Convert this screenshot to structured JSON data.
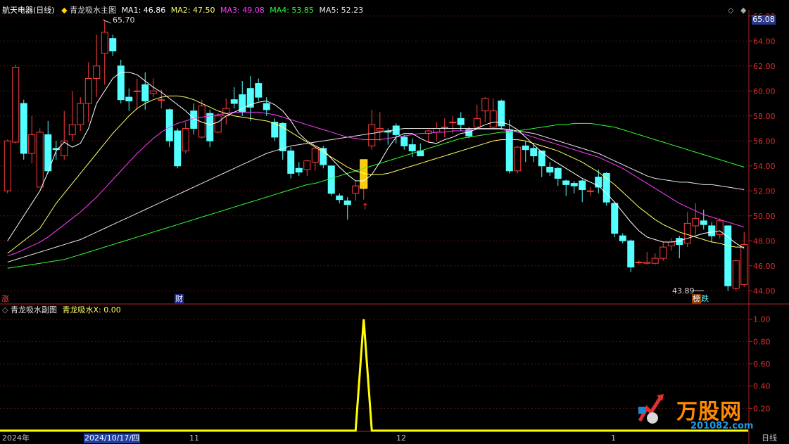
{
  "main_header": {
    "stock": "航天电器(日线)",
    "indicator": "青龙吸水主图",
    "ma1": "MA1: 46.86",
    "ma2": "MA2: 47.50",
    "ma3": "MA3: 49.08",
    "ma4": "MA4: 53.85",
    "ma5": "MA5: 52.23"
  },
  "sub_header": {
    "indicator": "青龙吸水副图",
    "value": "青龙吸水X: 0.00"
  },
  "current_price": "65.08",
  "markers": {
    "rise": "涨",
    "finance": "财",
    "list": "榜",
    "fall": "跌",
    "high_label": "65.70",
    "low_label": "43.89"
  },
  "x_axis": {
    "year": "2024年",
    "cursor_date": "2024/10/17/四",
    "m11": "11",
    "m12": "12",
    "m1": "1",
    "period": "日线"
  },
  "watermark": {
    "brand": "万股网",
    "url": "201082.com"
  },
  "colors": {
    "up": "#ff3d3d",
    "down": "#54ffff",
    "ma1": "#ffffff",
    "ma2": "#ffff66",
    "ma3": "#ff3dff",
    "ma4": "#33ff33",
    "ma5": "#e8e8e8",
    "signal": "#ffff00"
  },
  "chart_data": [
    {
      "type": "candlestick",
      "title": "青龙吸水主图",
      "y_range": [
        43,
        67
      ],
      "y_ticks": [
        "44.00",
        "46.00",
        "48.00",
        "50.00",
        "52.00",
        "54.00",
        "56.00",
        "58.00",
        "60.00",
        "62.00",
        "64.00",
        "66.00"
      ],
      "candles": [
        [
          52,
          56,
          51.8,
          56.1
        ],
        [
          55.9,
          61.9,
          55.8,
          62.1
        ],
        [
          59,
          55,
          54.5,
          59.3
        ],
        [
          55,
          56.5,
          54.2,
          58
        ],
        [
          52.3,
          56.7,
          52.3,
          57
        ],
        [
          56.5,
          53.6,
          53.4,
          57.6
        ],
        [
          55.4,
          55.3,
          54.5,
          56
        ],
        [
          54.8,
          56,
          54.5,
          58.4
        ],
        [
          56.5,
          57.3,
          56,
          60
        ],
        [
          57.3,
          59,
          56.8,
          59.5
        ],
        [
          59,
          61,
          57.5,
          62.3
        ],
        [
          61,
          62,
          59.5,
          64.5
        ],
        [
          63,
          64.7,
          60.5,
          65.7
        ],
        [
          64.2,
          63.2,
          62.8,
          64.5
        ],
        [
          62,
          59.3,
          59,
          62.5
        ],
        [
          59.5,
          59.2,
          58.4,
          60.2
        ],
        [
          60,
          60,
          58.5,
          61
        ],
        [
          60.5,
          59.2,
          58.5,
          61.5
        ],
        [
          59.8,
          60,
          59.5,
          61
        ],
        [
          59.3,
          59.3,
          58.6,
          60.1
        ],
        [
          58.5,
          56,
          55.5,
          58.6
        ],
        [
          56.8,
          54,
          53.8,
          57
        ],
        [
          55.2,
          57,
          55,
          57.5
        ],
        [
          58.4,
          57,
          56.5,
          59
        ],
        [
          56.3,
          58.8,
          56.2,
          59.3
        ],
        [
          58.2,
          56,
          55.5,
          58.5
        ],
        [
          56.7,
          58,
          56.6,
          58.2
        ],
        [
          58,
          58.6,
          57.3,
          59.4
        ],
        [
          59.3,
          59,
          58.6,
          60.3
        ],
        [
          59.7,
          58.3,
          58,
          60.8
        ],
        [
          60.2,
          58.7,
          57.6,
          61.2
        ],
        [
          60.6,
          59.5,
          59.2,
          61
        ],
        [
          59,
          58.5,
          58,
          59.5
        ],
        [
          57.5,
          56.3,
          56,
          57.8
        ],
        [
          57.4,
          55.2,
          54.5,
          57.5
        ],
        [
          55.2,
          53.4,
          53,
          55.5
        ],
        [
          53.8,
          53.5,
          53.2,
          54.3
        ],
        [
          53.7,
          54.4,
          53.2,
          54.5
        ],
        [
          54.3,
          55.4,
          53.6,
          55.5
        ],
        [
          55.4,
          54.1,
          53.8,
          55.6
        ],
        [
          54,
          51.8,
          51.6,
          54
        ],
        [
          51.6,
          51.3,
          51,
          51.8
        ],
        [
          51.2,
          50.9,
          49.7,
          51.5
        ],
        [
          51.8,
          52.4,
          51.2,
          52.8
        ],
        [
          52.2,
          54.5,
          51.3,
          54.5
        ],
        [
          55.6,
          57.3,
          55.3,
          58.5
        ],
        [
          56.8,
          57,
          56,
          58.3
        ],
        [
          56.8,
          56.7,
          55.7,
          57
        ],
        [
          57.2,
          56.5,
          55.8,
          57.4
        ],
        [
          56.3,
          55.6,
          55.3,
          56.5
        ],
        [
          55.7,
          55.2,
          54.7,
          56.2
        ],
        [
          55.2,
          54.8,
          54.8,
          55.8
        ],
        [
          56.6,
          56.8,
          55.9,
          56.9
        ],
        [
          56.7,
          57,
          56,
          57.5
        ],
        [
          57.1,
          57.1,
          56.3,
          57.8
        ],
        [
          57.5,
          57.5,
          56.6,
          58
        ],
        [
          57.8,
          57.3,
          56.8,
          58.3
        ],
        [
          56.9,
          56.4,
          56.2,
          57.1
        ],
        [
          57.1,
          57.8,
          57,
          58.9
        ],
        [
          58.4,
          59.4,
          57.5,
          59.5
        ],
        [
          57.1,
          58.4,
          57,
          59.4
        ],
        [
          59.2,
          57.2,
          56.9,
          59.3
        ],
        [
          56.9,
          53.6,
          53.4,
          57.7
        ],
        [
          53.6,
          55.5,
          53.4,
          55.6
        ],
        [
          55.6,
          55.3,
          54.3,
          56
        ],
        [
          55.4,
          54.8,
          54.3,
          55.8
        ],
        [
          55.2,
          54,
          53.1,
          55.2
        ],
        [
          53.9,
          53.5,
          53.2,
          54.3
        ],
        [
          53.8,
          53,
          52.4,
          53.9
        ],
        [
          52.8,
          52.5,
          51.6,
          52.9
        ],
        [
          52.6,
          52.4,
          51.8,
          52.8
        ],
        [
          52.8,
          52.1,
          51.1,
          52.9
        ],
        [
          52,
          52,
          51.6,
          52.3
        ],
        [
          53.1,
          52.3,
          51.8,
          53.7
        ],
        [
          53.4,
          51.1,
          50.8,
          53.5
        ],
        [
          51,
          48.6,
          48.3,
          51.1
        ],
        [
          48.4,
          48,
          47.8,
          48.6
        ],
        [
          48,
          45.9,
          45.5,
          48.1
        ],
        [
          46.3,
          46.3,
          46.1,
          46.4
        ],
        [
          46.2,
          46.3,
          46.1,
          47.1
        ],
        [
          46.2,
          46.6,
          46.1,
          47
        ],
        [
          46.6,
          47.5,
          46.4,
          47.9
        ],
        [
          47.6,
          47.9,
          47.2,
          48.2
        ],
        [
          48.2,
          47.7,
          46.6,
          48.4
        ],
        [
          47.8,
          49.4,
          47.5,
          50.3
        ],
        [
          49.2,
          49.8,
          48.5,
          51
        ],
        [
          49.6,
          49.3,
          48.9,
          50.5
        ],
        [
          49.2,
          48.4,
          47.9,
          49.5
        ],
        [
          48.5,
          49.6,
          48.2,
          49.8
        ],
        [
          49.2,
          44.4,
          44,
          49.2
        ],
        [
          44.2,
          46.4,
          44,
          46.5
        ],
        [
          44.5,
          47.7,
          44.3,
          48.7
        ]
      ],
      "ma1_values": [
        48,
        49,
        50,
        51,
        52,
        53.5,
        55.2,
        55.9,
        55.5,
        55.8,
        57,
        59,
        60,
        61,
        61.5,
        61.5,
        61.3,
        60.8,
        60.3,
        59.9,
        59.4,
        58.9,
        58.4,
        57.8,
        57.5,
        57.3,
        57.5,
        58,
        58.3,
        58.6,
        58.9,
        59.1,
        59.2,
        58.9,
        58.4,
        57.6,
        56.6,
        56,
        55.6,
        55.3,
        54.6,
        53.9,
        53.3,
        52.8,
        52.8,
        53.3,
        54.3,
        55.4,
        56.3,
        56.6,
        56.6,
        56.2,
        55.9,
        55.8,
        56.1,
        56.3,
        56.6,
        56.7,
        57,
        57.3,
        57.5,
        57.5,
        57.3,
        56.9,
        56.3,
        55.7,
        55.1,
        54.6,
        54.2,
        53.8,
        53.4,
        53,
        52.7,
        52.4,
        51.8,
        51.1,
        50.3,
        49.5,
        48.8,
        48.3,
        48.1,
        47.9,
        47.9,
        48,
        48.2,
        48.4,
        48.6,
        48.7,
        48.8,
        48.3,
        47.8,
        47.4
      ],
      "ma2_values": [
        47,
        47.5,
        48,
        48.5,
        49,
        50,
        51,
        51.8,
        52.6,
        53.4,
        54.2,
        55,
        55.8,
        56.6,
        57.3,
        58,
        58.6,
        59,
        59.3,
        59.5,
        59.6,
        59.6,
        59.5,
        59.3,
        59,
        58.7,
        58.4,
        58.2,
        58,
        57.9,
        57.8,
        57.7,
        57.6,
        57.4,
        57.1,
        56.7,
        56.3,
        55.9,
        55.5,
        55.1,
        54.7,
        54.3,
        53.9,
        53.6,
        53.4,
        53.3,
        53.3,
        53.4,
        53.6,
        53.8,
        54,
        54.2,
        54.4,
        54.6,
        54.8,
        55,
        55.2,
        55.4,
        55.6,
        55.8,
        56,
        56.1,
        56.1,
        56.1,
        56,
        55.8,
        55.6,
        55.4,
        55.2,
        54.9,
        54.6,
        54.3,
        53.9,
        53.5,
        53,
        52.5,
        51.9,
        51.3,
        50.7,
        50.2,
        49.7,
        49.3,
        49,
        48.7,
        48.5,
        48.3,
        48.1,
        47.9,
        47.8,
        47.6,
        47.5,
        47.5
      ],
      "ma3_values": [
        46.8,
        47,
        47.3,
        47.6,
        47.9,
        48.3,
        48.8,
        49.3,
        49.8,
        50.3,
        50.9,
        51.5,
        52.2,
        52.9,
        53.6,
        54.3,
        55,
        55.6,
        56.2,
        56.7,
        57.1,
        57.4,
        57.6,
        57.8,
        57.9,
        58,
        58.1,
        58.2,
        58.3,
        58.3,
        58.3,
        58.3,
        58.2,
        58.1,
        57.9,
        57.7,
        57.5,
        57.3,
        57.1,
        56.9,
        56.7,
        56.5,
        56.3,
        56.2,
        56.1,
        56.1,
        56.1,
        56.2,
        56.3,
        56.4,
        56.5,
        56.6,
        56.6,
        56.7,
        56.7,
        56.8,
        56.8,
        56.8,
        56.9,
        56.9,
        56.9,
        56.9,
        56.8,
        56.7,
        56.5,
        56.3,
        56.1,
        55.9,
        55.7,
        55.5,
        55.3,
        55.1,
        54.9,
        54.7,
        54.4,
        54.1,
        53.8,
        53.4,
        53,
        52.6,
        52.2,
        51.8,
        51.4,
        51,
        50.7,
        50.4,
        50.1,
        49.9,
        49.7,
        49.5,
        49.3,
        49.1
      ],
      "ma4_values": [
        45.8,
        45.9,
        46,
        46.1,
        46.2,
        46.3,
        46.4,
        46.5,
        46.7,
        46.9,
        47.1,
        47.3,
        47.5,
        47.7,
        47.9,
        48.1,
        48.3,
        48.5,
        48.7,
        48.9,
        49.1,
        49.3,
        49.5,
        49.7,
        49.9,
        50.1,
        50.3,
        50.5,
        50.7,
        50.9,
        51.1,
        51.3,
        51.5,
        51.7,
        51.9,
        52.1,
        52.3,
        52.5,
        52.6,
        52.8,
        53,
        53.2,
        53.4,
        53.6,
        53.8,
        54,
        54.2,
        54.4,
        54.6,
        54.8,
        55,
        55.2,
        55.4,
        55.6,
        55.8,
        56,
        56.2,
        56.3,
        56.4,
        56.5,
        56.6,
        56.7,
        56.7,
        56.8,
        56.9,
        57,
        57.1,
        57.2,
        57.3,
        57.3,
        57.4,
        57.4,
        57.4,
        57.3,
        57.2,
        57.1,
        56.9,
        56.7,
        56.5,
        56.3,
        56.1,
        55.9,
        55.7,
        55.5,
        55.3,
        55.1,
        54.9,
        54.7,
        54.5,
        54.3,
        54.1,
        53.9
      ],
      "ma5_values": [
        46.3,
        46.5,
        46.7,
        46.9,
        47.1,
        47.3,
        47.5,
        47.7,
        47.9,
        48.1,
        48.4,
        48.7,
        49,
        49.3,
        49.6,
        49.9,
        50.2,
        50.5,
        50.8,
        51.1,
        51.4,
        51.7,
        52,
        52.3,
        52.6,
        52.9,
        53.2,
        53.5,
        53.8,
        54.1,
        54.4,
        54.7,
        55,
        55.2,
        55.4,
        55.6,
        55.7,
        55.8,
        55.9,
        56,
        56.1,
        56.2,
        56.3,
        56.4,
        56.5,
        56.6,
        56.7,
        56.8,
        56.9,
        57,
        57,
        57,
        57,
        57,
        57,
        57,
        57,
        57,
        57,
        57,
        57,
        57,
        56.9,
        56.8,
        56.7,
        56.6,
        56.4,
        56.2,
        56,
        55.8,
        55.6,
        55.4,
        55.2,
        55,
        54.7,
        54.4,
        54.1,
        53.8,
        53.5,
        53.2,
        53,
        52.9,
        52.8,
        52.7,
        52.7,
        52.6,
        52.5,
        52.5,
        52.4,
        52.3,
        52.2,
        52.1
      ],
      "high": 65.7,
      "low": 43.89
    },
    {
      "type": "line",
      "title": "青龙吸水副图",
      "series": [
        {
          "name": "青龙吸水X",
          "values": [
            0,
            0,
            0,
            0,
            0,
            0,
            0,
            0,
            0,
            0,
            0,
            0,
            0,
            0,
            0,
            0,
            0,
            0,
            0,
            0,
            0,
            0,
            0,
            0,
            0,
            0,
            0,
            0,
            0,
            0,
            0,
            0,
            0,
            0,
            0,
            0,
            0,
            0,
            0,
            0,
            0,
            0,
            0,
            0,
            1,
            0,
            0,
            0,
            0,
            0,
            0,
            0,
            0,
            0,
            0,
            0,
            0,
            0,
            0,
            0,
            0,
            0,
            0,
            0,
            0,
            0,
            0,
            0,
            0,
            0,
            0,
            0,
            0,
            0,
            0,
            0,
            0,
            0,
            0,
            0,
            0,
            0,
            0,
            0,
            0,
            0,
            0,
            0,
            0,
            0,
            0,
            0
          ]
        }
      ],
      "y_range": [
        0,
        1.1
      ],
      "y_ticks": [
        "0.20",
        "0.40",
        "0.60",
        "0.80",
        "1.00"
      ]
    }
  ]
}
